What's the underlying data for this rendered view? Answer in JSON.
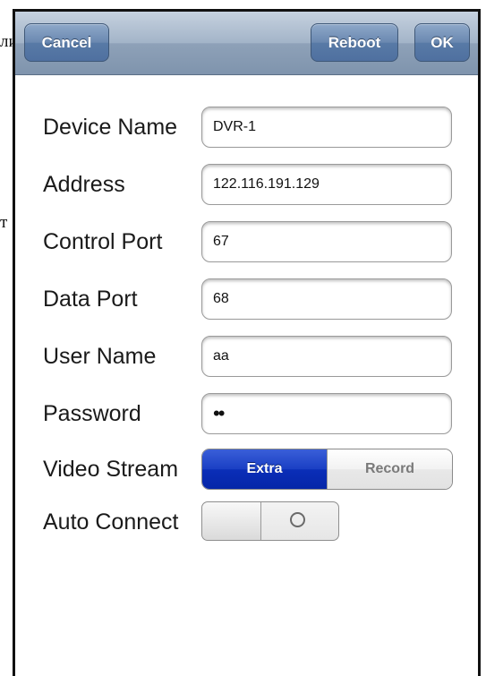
{
  "background_text": [
    "ли",
    "т"
  ],
  "navbar": {
    "cancel_label": "Cancel",
    "reboot_label": "Reboot",
    "ok_label": "OK"
  },
  "form": {
    "device_name": {
      "label": "Device Name",
      "value": "DVR-1"
    },
    "address": {
      "label": "Address",
      "value": "122.116.191.129"
    },
    "control_port": {
      "label": "Control Port",
      "value": "67"
    },
    "data_port": {
      "label": "Data Port",
      "value": "68"
    },
    "user_name": {
      "label": "User Name",
      "value": "aa"
    },
    "password": {
      "label": "Password",
      "value": "••"
    },
    "video_stream": {
      "label": "Video Stream",
      "options": [
        "Extra",
        "Record"
      ],
      "selected": "Extra"
    },
    "auto_connect": {
      "label": "Auto Connect",
      "state": "off"
    }
  },
  "colors": {
    "navbar": "#8ea1b8",
    "button": "#587aa6",
    "segment_selected": "#0a2eb8"
  }
}
